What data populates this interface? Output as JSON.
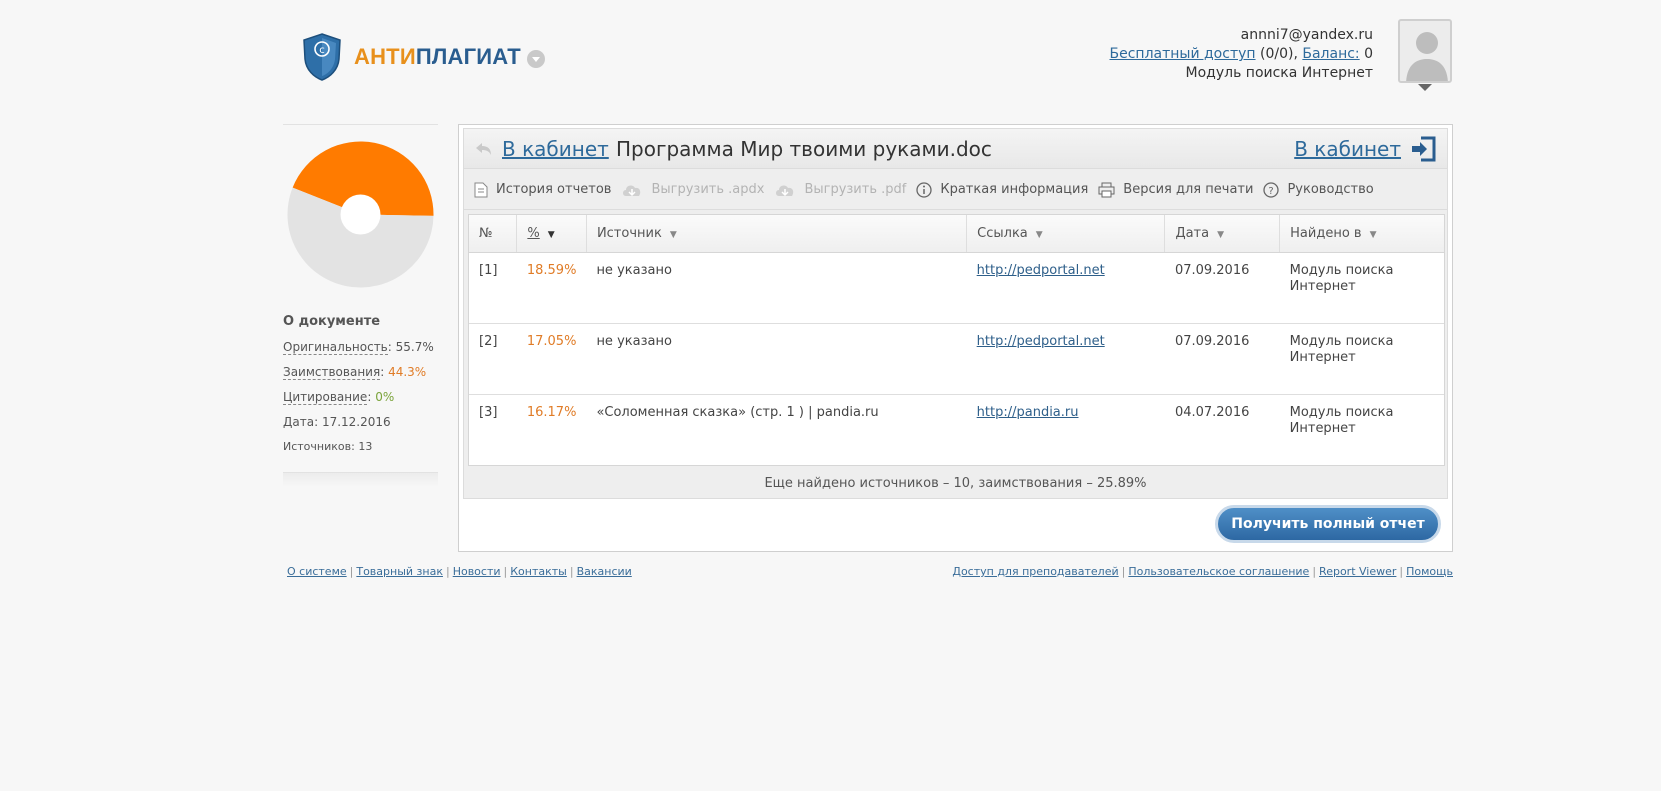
{
  "brand": {
    "name_part1": "АНТИ",
    "name_part2": "ПЛАГИАТ",
    "colors": {
      "orange": "#e8901c",
      "blue": "#2a5d8f"
    }
  },
  "user": {
    "email": "annni7@yandex.ru",
    "free_access_label": "Бесплатный доступ",
    "free_access_value": " (0/0), ",
    "balance_label": "Баланс:",
    "balance_value": " 0",
    "module": "Модуль поиска Интернет"
  },
  "sidebar": {
    "chart_data": {
      "type": "pie",
      "slices": [
        {
          "label": "Оригинальность",
          "value": 55.7,
          "color": "#e3e3e3"
        },
        {
          "label": "Заимствования",
          "value": 44.3,
          "color": "#ff7b00"
        },
        {
          "label": "Цитирование",
          "value": 0,
          "color": "#7aa33a"
        }
      ]
    },
    "title": "О документе",
    "originality_label": "Оригинальность",
    "originality_value": "55.7%",
    "borrowing_label": "Заимствования",
    "borrowing_value": "44.3%",
    "citation_label": "Цитирование",
    "citation_value": "0%",
    "date_label": "Дата:",
    "date_value": "17.12.2016",
    "sources_label": "Источников:",
    "sources_value": "13"
  },
  "panel": {
    "back_link": "В кабинет",
    "document_name": "Программа Мир твоими руками.doc",
    "cabinet_link": "В кабинет",
    "toolbar": {
      "history": "История отчетов",
      "export_apdx": "Выгрузить .apdx",
      "export_pdf": "Выгрузить .pdf",
      "brief_info": "Краткая информация",
      "print_version": "Версия для печати",
      "guide": "Руководство"
    },
    "table": {
      "headers": {
        "num": "№",
        "percent": "%",
        "source": "Источник",
        "link": "Ссылка",
        "date": "Дата",
        "found_in": "Найдено в"
      },
      "rows": [
        {
          "num": "[1]",
          "percent": "18.59%",
          "source": "не указано",
          "link": "http://pedportal.net",
          "date": "07.09.2016",
          "found_in": "Модуль поиска Интернет"
        },
        {
          "num": "[2]",
          "percent": "17.05%",
          "source": "не указано",
          "link": "http://pedportal.net",
          "date": "07.09.2016",
          "found_in": "Модуль поиска Интернет"
        },
        {
          "num": "[3]",
          "percent": "16.17%",
          "source": "«Соломенная сказка» (стр. 1 ) | pandia.ru",
          "link": "http://pandia.ru",
          "date": "04.07.2016",
          "found_in": "Модуль поиска Интернет"
        }
      ]
    },
    "more_sources": "Еще найдено источников – 10, заимствования – 25.89%",
    "full_report_button": "Получить полный отчет"
  },
  "footer": {
    "left": [
      "О системе",
      "Товарный знак",
      "Новости",
      "Контакты",
      "Вакансии"
    ],
    "right": [
      "Доступ для преподавателей",
      "Пользовательское соглашение",
      "Report Viewer",
      "Помощь"
    ]
  }
}
